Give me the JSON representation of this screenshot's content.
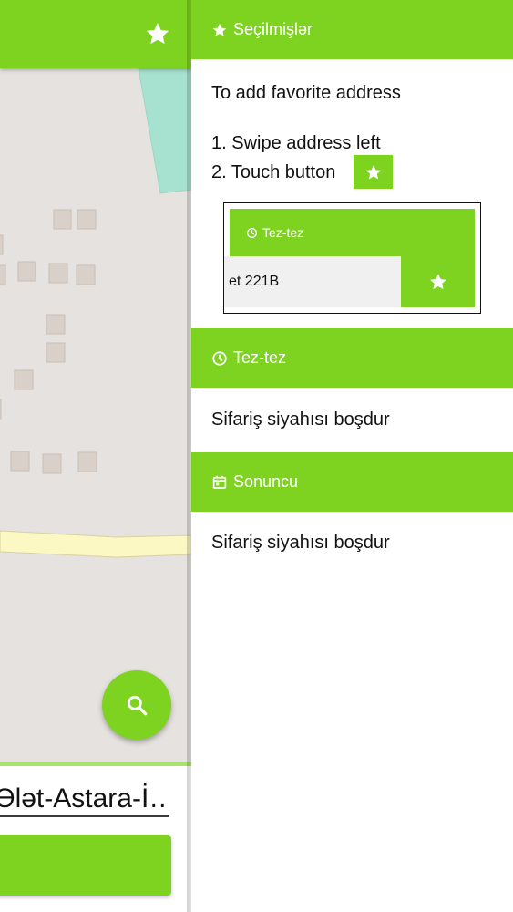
{
  "map": {
    "toolbar_icon": "star-icon",
    "address_value": "Ələt-Astara-İ…",
    "search_icon": "search-icon"
  },
  "drawer": {
    "favorites": {
      "title": "Seçilmişlər",
      "icon": "star-icon",
      "instruction_title": "To add favorite address",
      "step1": "1. Swipe address left",
      "step2": "2. Touch button",
      "demo": {
        "header_title": "Tez-tez",
        "address": "et 221B"
      }
    },
    "frequent": {
      "title": "Tez-tez",
      "icon": "clock-icon",
      "empty_text": "Sifariş siyahısı boşdur"
    },
    "recent": {
      "title": "Sonuncu",
      "icon": "calendar-icon",
      "empty_text": "Sifariş siyahısı boşdur"
    }
  },
  "colors": {
    "accent": "#7ed321",
    "map_background": "#e5e2df",
    "road": "#fbf8c4",
    "park": "#a7e1cf"
  }
}
